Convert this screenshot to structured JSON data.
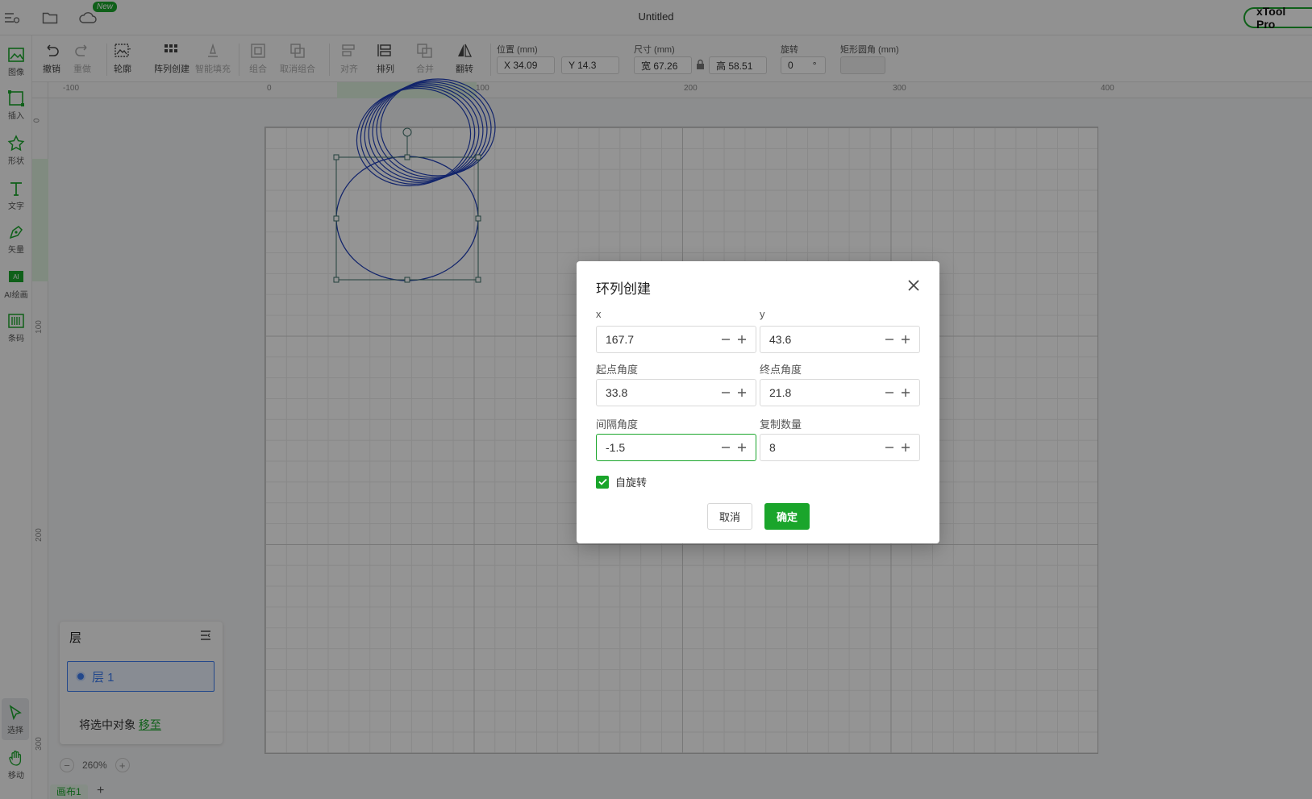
{
  "window": {
    "title": "Untitled",
    "brand": "xTool Pro",
    "new_badge": "New"
  },
  "left_toolbar": [
    {
      "label": "图像",
      "icon": "image-icon"
    },
    {
      "label": "插入",
      "icon": "insert-icon"
    },
    {
      "label": "形状",
      "icon": "star-shape-icon"
    },
    {
      "label": "文字",
      "icon": "text-icon"
    },
    {
      "label": "矢量",
      "icon": "pen-icon"
    },
    {
      "label": "AI绘画",
      "icon": "ai-paint-icon"
    },
    {
      "label": "条码",
      "icon": "barcode-icon"
    },
    {
      "label": "选择",
      "icon": "select-cursor-icon",
      "active": true
    },
    {
      "label": "移动",
      "icon": "hand-icon"
    }
  ],
  "toolbar": {
    "undo": "撤销",
    "redo": "重做",
    "outline": "轮廓",
    "array": "阵列创建",
    "smart_fill": "智能填充",
    "group": "组合",
    "ungroup": "取消组合",
    "align": "对齐",
    "arrange": "排列",
    "merge": "合并",
    "flip": "翻转",
    "position_label": "位置 (mm)",
    "pos_x": "X 34.09",
    "pos_y": "Y 14.3",
    "size_label": "尺寸 (mm)",
    "width": "宽 67.26",
    "height": "高 58.51",
    "rotate_label": "旋转",
    "rotate_value": "0",
    "rotate_unit": "°",
    "corner_label": "矩形圆角 (mm)",
    "corner_value": ""
  },
  "rulers": {
    "top": [
      "-100",
      "0",
      "100",
      "200",
      "300",
      "400"
    ],
    "left": [
      "0",
      "100",
      "200",
      "300"
    ]
  },
  "layers": {
    "title": "层",
    "items": [
      {
        "name": "层 1"
      }
    ],
    "move_text": "将选中对象",
    "move_link": "移至"
  },
  "zoom": {
    "value": "260%",
    "minus": "−",
    "plus": "+"
  },
  "canvas_tabs": [
    {
      "name": "画布1"
    }
  ],
  "add_tab": "+",
  "dialog": {
    "title": "环列创建",
    "fields": {
      "x": {
        "label": "x",
        "value": "167.7"
      },
      "y": {
        "label": "y",
        "value": "43.6"
      },
      "start_angle": {
        "label": "起点角度",
        "value": "33.8"
      },
      "end_angle": {
        "label": "终点角度",
        "value": "21.8"
      },
      "interval_angle": {
        "label": "间隔角度",
        "value": "-1.5"
      },
      "copy_count": {
        "label": "复制数量",
        "value": "8"
      }
    },
    "self_rotate": {
      "label": "自旋转",
      "checked": true
    },
    "cancel": "取消",
    "ok": "确定"
  },
  "colors": {
    "accent": "#1aa52b",
    "shape_stroke": "#1f3fb8",
    "selection": "#3c6e68"
  }
}
